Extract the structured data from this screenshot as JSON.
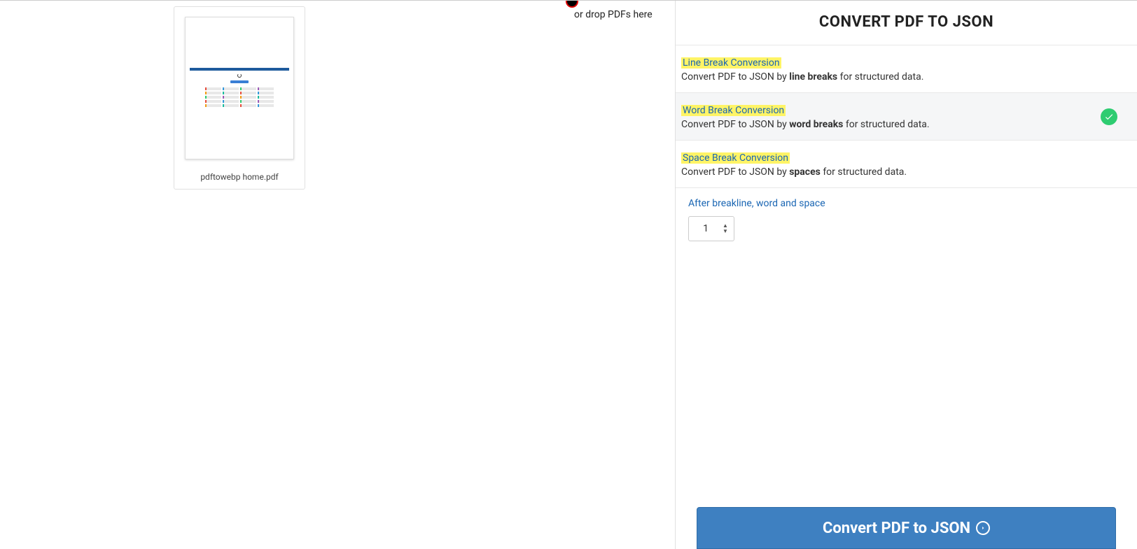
{
  "dropzone": {
    "hint": "or drop PDFs here"
  },
  "file": {
    "name": "pdftowebp home.pdf"
  },
  "panel": {
    "title": "CONVERT PDF TO JSON",
    "options": [
      {
        "title": "Line Break Conversion",
        "desc_prefix": "Convert PDF to JSON by ",
        "desc_bold": "line breaks",
        "desc_suffix": " for structured data."
      },
      {
        "title": "Word Break Conversion",
        "desc_prefix": "Convert PDF to JSON by ",
        "desc_bold": "word breaks",
        "desc_suffix": " for structured data."
      },
      {
        "title": "Space Break Conversion",
        "desc_prefix": "Convert PDF to JSON by ",
        "desc_bold": "spaces",
        "desc_suffix": " for structured data."
      }
    ],
    "after_label": "After breakline, word and space",
    "number_value": "1",
    "convert_button": "Convert PDF to JSON"
  }
}
